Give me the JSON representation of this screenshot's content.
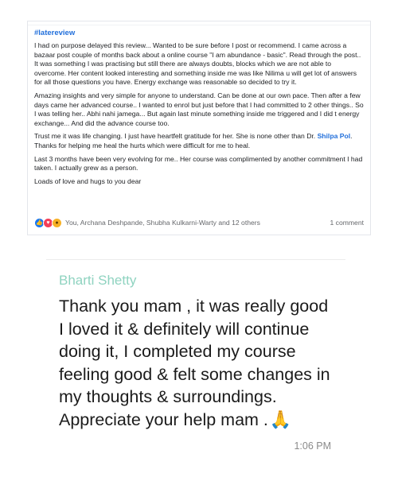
{
  "review_post": {
    "hashtag": "#latereview",
    "paragraphs": [
      "I had on purpose delayed this review... Wanted to be sure before I post or recommend. I came across a bazaar post couple of months back about a online course \"I am abundance - basic\". Read through the post.. It was something I was practising but still there are always doubts, blocks which we are not able to overcome. Her content looked interesting and something inside me was like Nilima u will get lot of answers for all those questions you have. Energy exchange was reasonable  so decided to try it.",
      "Amazing insights and very simple for anyone to understand. Can be done at our own pace. Then after a few days came her advanced course.. I wanted to enrol but just before that I  had committed to 2 other things.. So I was telling her.. Abhi nahi jamega... But again last minute something inside me triggered and I did t energy exchange... And did the advance course too."
    ],
    "trust_prefix": "Trust me it was life changing. I just have heartfelt gratitude for her. She is none other than Dr.",
    "mention": "Shilpa Pol",
    "trust_suffix": ". Thanks for helping me heal the hurts which were difficult for me to heal.",
    "last_months": "Last 3 months have been very evolving for me.. Her course was complimented by another commitment I had taken. I actually grew as a person.",
    "closing": "Loads of love and hugs to you dear",
    "reactions_text": "You, Archana Deshpande, Shubha Kulkarni-Warty and 12 others",
    "comments_count": "1 comment",
    "reaction_icons": [
      "like-icon",
      "love-icon",
      "wow-icon"
    ]
  },
  "chat_message": {
    "sender": "Bharti Shetty",
    "text": "Thank you mam , it was really good I loved it & definitely will continue doing it,  I completed my course feeling good & felt some changes in my thoughts & surroundings. Appreciate your help mam .",
    "emoji": "🙏",
    "time": "1:06 PM"
  },
  "colors": {
    "link_blue": "#216fdb",
    "sender_teal": "#8fd3c0",
    "time_gray": "#8a8a8a"
  }
}
